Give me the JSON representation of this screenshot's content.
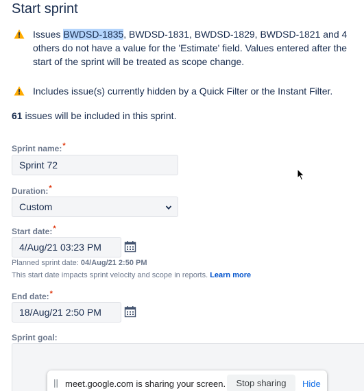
{
  "dialog": {
    "title": "Start sprint"
  },
  "warnings": {
    "estimate": {
      "prefix": "Issues ",
      "highlighted_issue": "BWDSD-1835",
      "rest": ", BWDSD-1831, BWDSD-1829, BWDSD-1821 and 4 others do not have a value for the 'Estimate' field. Values entered after the start of the sprint will be treated as scope change."
    },
    "filter": {
      "text": "Includes issue(s) currently hidden by a Quick Filter or the Instant Filter."
    },
    "icon": "warning-triangle-icon",
    "icon_color": "#ffab00"
  },
  "summary": {
    "count": "61",
    "text": " issues will be included in this sprint."
  },
  "form": {
    "sprint_name": {
      "label": "Sprint name:",
      "required_mark": "*",
      "value": "Sprint 72"
    },
    "duration": {
      "label": "Duration:",
      "required_mark": "*",
      "selected": "Custom"
    },
    "start_date": {
      "label": "Start date:",
      "required_mark": "*",
      "value": "4/Aug/21 03:23 PM",
      "planned_label": "Planned sprint date: ",
      "planned_value": "04/Aug/21 2:50 PM",
      "note": "This start date impacts sprint velocity and scope in reports. ",
      "learn_more": "Learn more"
    },
    "end_date": {
      "label": "End date:",
      "required_mark": "*",
      "value": "18/Aug/21 2:50 PM"
    },
    "sprint_goal": {
      "label": "Sprint goal:"
    }
  },
  "screen_share": {
    "message": "meet.google.com is sharing your screen.",
    "stop_label": "Stop sharing",
    "hide_label": "Hide"
  },
  "colors": {
    "required": "#de350b",
    "link": "#0052cc",
    "highlight": "#b3d4fc"
  }
}
